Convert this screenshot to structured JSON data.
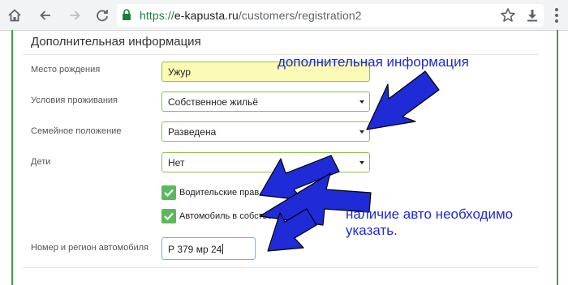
{
  "browser": {
    "url_scheme": "https://",
    "url_host": "e-kapusta.ru",
    "url_path": "/customers/registration2"
  },
  "form": {
    "section_title": "Дополнительная информация",
    "birthplace": {
      "label": "Место рождения",
      "value": "Ужур"
    },
    "living_conditions": {
      "label": "Условия проживания",
      "value": "Собственное жильё"
    },
    "marital_status": {
      "label": "Семейное положение",
      "value": "Разведена"
    },
    "children": {
      "label": "Дети",
      "value": "Нет"
    },
    "drivers_license": {
      "label": "Водительские прав",
      "checked": true
    },
    "has_car": {
      "label": "Автомобиль в собстве",
      "checked": true
    },
    "car_number": {
      "label": "Номер и регион автомобиля",
      "value": "Р 379 мр 24"
    }
  },
  "annotations": {
    "top_note": "дополнительная информация",
    "bottom_note_line1": "наличие авто необходимо",
    "bottom_note_line2": "указать.",
    "arrow_color": "#1e2bd6"
  },
  "colors": {
    "frame_border": "#43a047",
    "field_border": "#8bc34a",
    "highlight_field": "#fbfbb6",
    "checkbox": "#5cb85c"
  }
}
